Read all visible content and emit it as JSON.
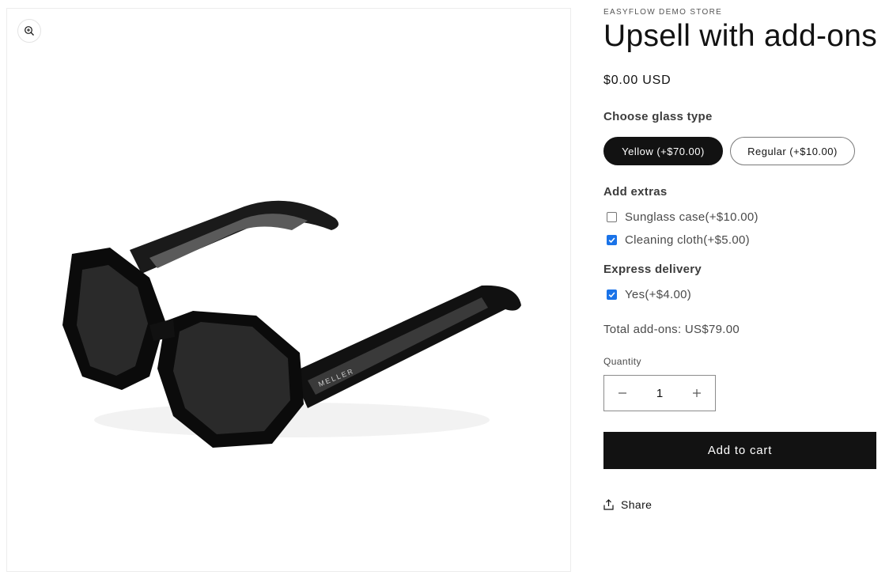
{
  "product": {
    "vendor": "EASYFLOW DEMO STORE",
    "title": "Upsell with add-ons",
    "price": "$0.00 USD",
    "image_icon": "sunglasses-image",
    "image_brand_text": "MELLER"
  },
  "glass_type": {
    "label": "Choose glass type",
    "options": [
      {
        "label": "Yellow (+$70.00)",
        "selected": true
      },
      {
        "label": "Regular (+$10.00)",
        "selected": false
      }
    ]
  },
  "extras": {
    "label": "Add extras",
    "options": [
      {
        "label": "Sunglass case(+$10.00)",
        "checked": false
      },
      {
        "label": "Cleaning cloth(+$5.00)",
        "checked": true
      }
    ]
  },
  "express": {
    "label": "Express delivery",
    "options": [
      {
        "label": "Yes(+$4.00)",
        "checked": true
      }
    ]
  },
  "total_addons": "Total add-ons: US$79.00",
  "quantity": {
    "label": "Quantity",
    "value": "1",
    "minus_icon": "minus-icon",
    "plus_icon": "plus-icon"
  },
  "add_to_cart": "Add to cart",
  "share": {
    "label": "Share",
    "icon": "share-icon"
  },
  "colors": {
    "primary": "#121212",
    "checkbox_checked": "#1a73e8"
  }
}
